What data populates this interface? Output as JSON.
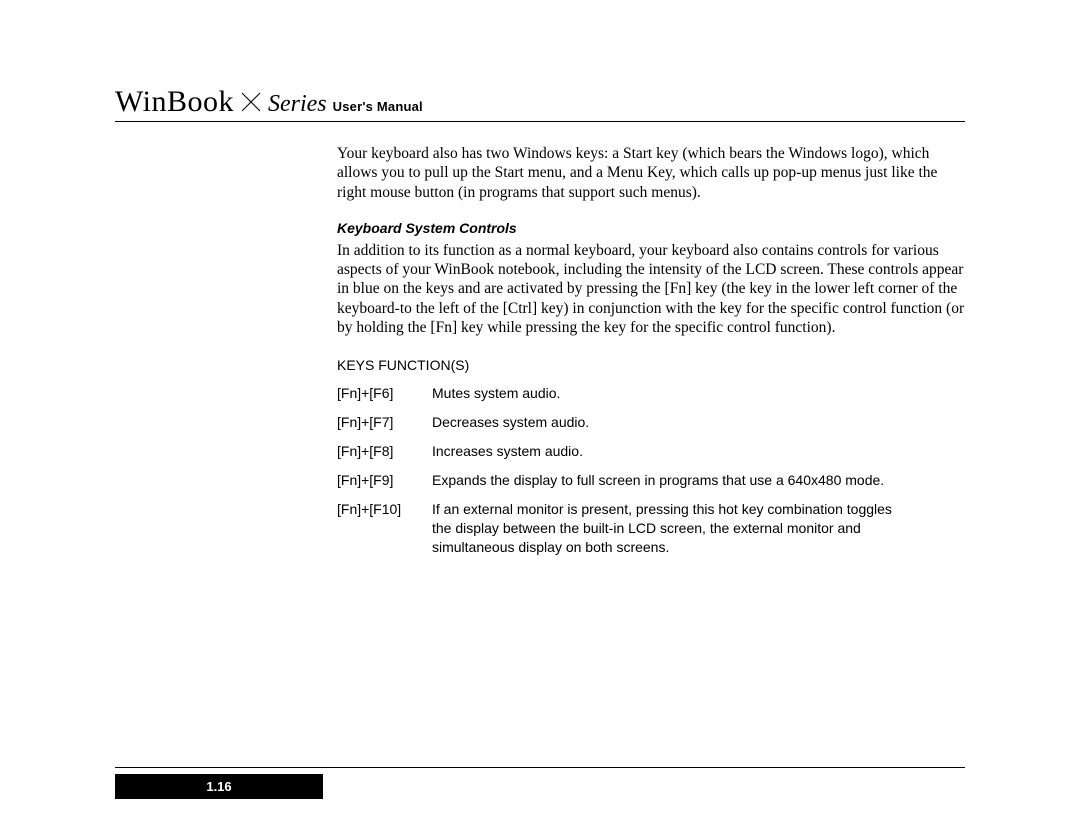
{
  "header": {
    "brand": "WinBook",
    "series": "Series",
    "manual": "User's Manual"
  },
  "intro_para": "Your keyboard also has two Windows keys: a Start key (which bears the Windows logo), which allows you to pull up the Start menu, and a Menu Key, which calls up pop-up menus just like the right mouse button (in programs that support such menus).",
  "section_heading": "Keyboard System Controls",
  "section_para": "In addition to its function as a normal keyboard, your keyboard also contains controls for various aspects of your WinBook notebook, including the intensity of the LCD screen. These controls appear in blue on the keys and are activated by pressing the [Fn] key (the key in the lower left corner of the keyboard-to the left of the [Ctrl] key) in conjunction with the key for the specific control function (or by holding the [Fn] key while pressing the key for the specific control function).",
  "table_header": "KEYS FUNCTION(S)",
  "key_rows": [
    {
      "key": "[Fn]+[F6]",
      "fn": "Mutes system audio."
    },
    {
      "key": "[Fn]+[F7]",
      "fn": "Decreases system audio."
    },
    {
      "key": "[Fn]+[F8]",
      "fn": "Increases system audio."
    },
    {
      "key": "[Fn]+[F9]",
      "fn": "Expands the display to full screen in programs that use a 640x480 mode."
    },
    {
      "key": "[Fn]+[F10]",
      "fn": "If an external monitor is present, pressing this hot key combination toggles the display between the built-in LCD screen, the external monitor and simultaneous display on both screens."
    }
  ],
  "page_number": "1.16"
}
